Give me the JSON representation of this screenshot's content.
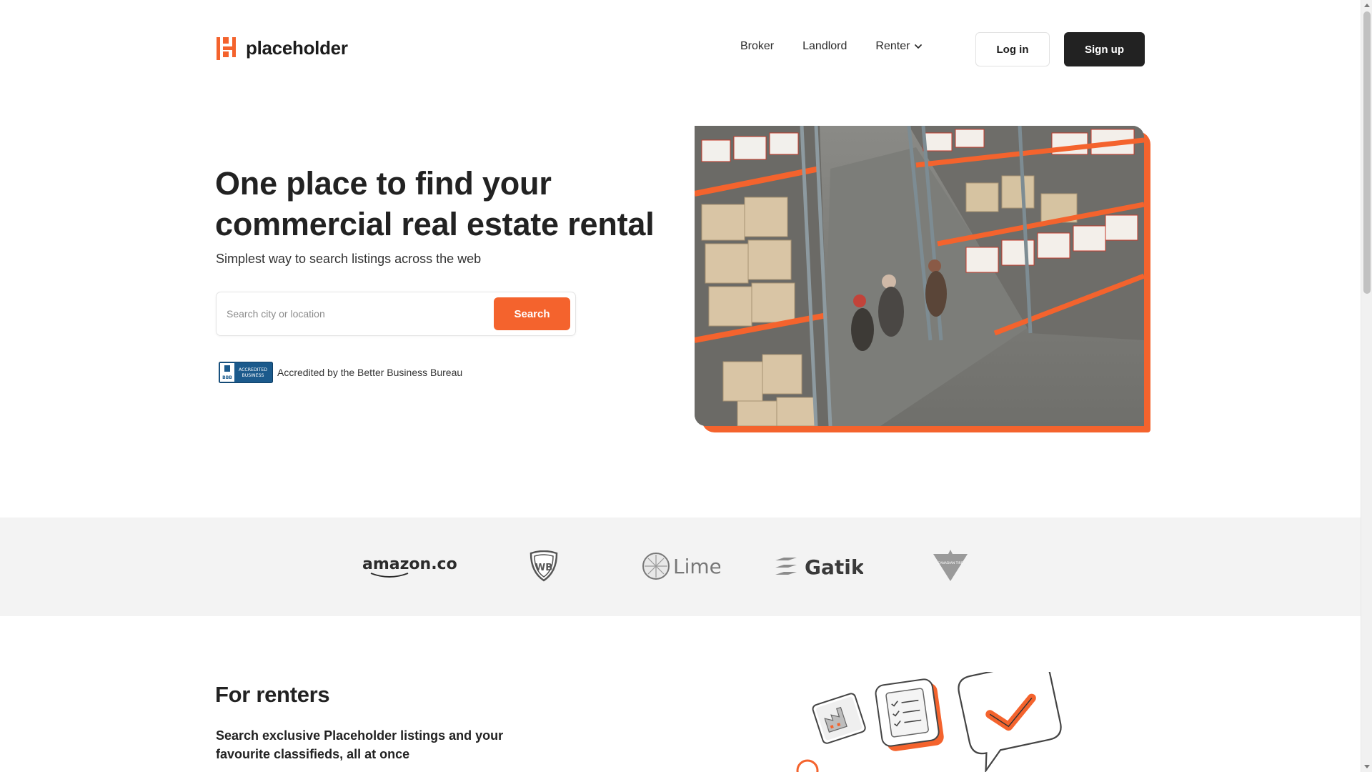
{
  "brand": {
    "name": "placeholder",
    "accent": "#f4632d",
    "dark": "#222222"
  },
  "nav": {
    "items": [
      {
        "label": "Broker"
      },
      {
        "label": "Landlord"
      },
      {
        "label": "Renter",
        "icon": "chevron-down-icon"
      }
    ],
    "login_label": "Log in",
    "signup_label": "Sign up"
  },
  "hero": {
    "title_line1": "One place to find your",
    "title_line2": "commercial real estate rental",
    "subtitle": "Simplest way to search listings across the web",
    "search": {
      "placeholder": "Search city or location",
      "value": "",
      "button_label": "Search"
    },
    "bbb": {
      "badge_line1": "ACCREDITED",
      "badge_line2": "BUSINESS",
      "badge_logo": "BBB",
      "text": "Accredited by the Better Business Bureau"
    },
    "image": "warehouse-photo"
  },
  "brands": {
    "logos": [
      {
        "name": "amazon",
        "text": "amazon.com"
      },
      {
        "name": "warner-bros",
        "text": "WB"
      },
      {
        "name": "lime",
        "text": "Lime"
      },
      {
        "name": "gatik",
        "text": "Gatik"
      },
      {
        "name": "canadian-tire",
        "text": "CANADIAN TIRE"
      }
    ]
  },
  "renters": {
    "title": "For renters",
    "subtitle": "Search exclusive Placeholder listings and your favourite classifieds, all at once"
  }
}
